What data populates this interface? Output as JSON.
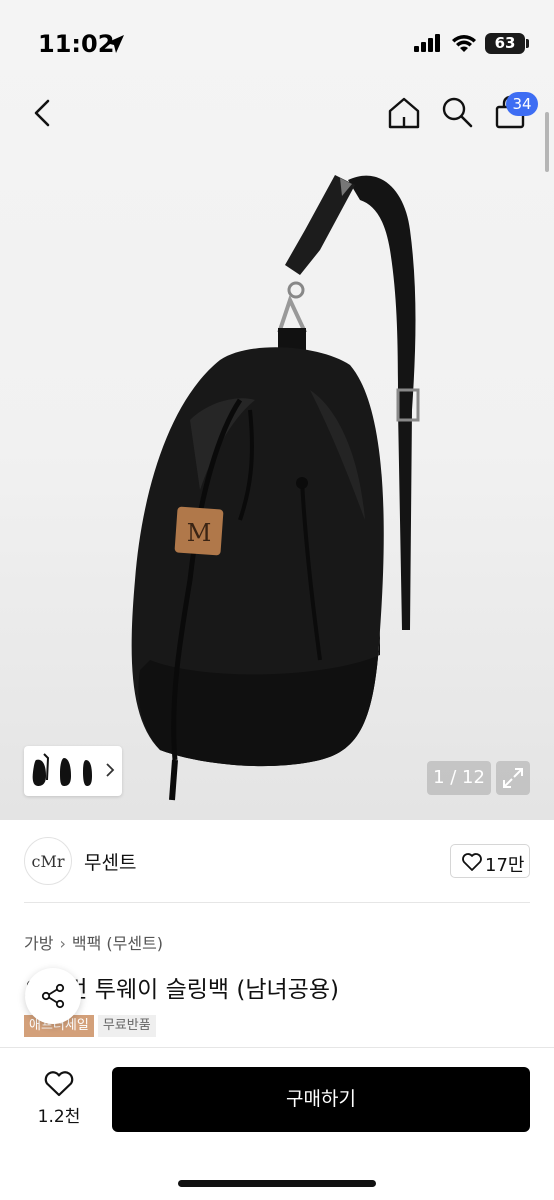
{
  "status_bar": {
    "time": "11:02",
    "battery": "63"
  },
  "nav": {
    "cart_count": "34"
  },
  "gallery": {
    "counter": "1 / 12",
    "logo_patch": "M"
  },
  "brand": {
    "logo_text": "cMr",
    "name": "무센트",
    "like_count": "17만"
  },
  "breadcrumb": {
    "items": [
      "가방",
      "백팩 (무센트)"
    ]
  },
  "product": {
    "title": "오버런 투웨이 슬링백 (남녀공용)",
    "tags": [
      "애프터세일",
      "무료반품"
    ]
  },
  "bottom_bar": {
    "wish_count": "1.2천",
    "buy_label": "구매하기"
  },
  "colors": {
    "accent_badge": "#3d6df3",
    "sale_tag": "#d3a07a",
    "buy_button": "#000000"
  },
  "icons": [
    "location-arrow-icon",
    "signal-icon",
    "wifi-icon",
    "back-chevron-icon",
    "home-icon",
    "search-icon",
    "shopping-bag-icon",
    "expand-icon",
    "heart-icon",
    "share-icon",
    "chevron-right-icon"
  ]
}
